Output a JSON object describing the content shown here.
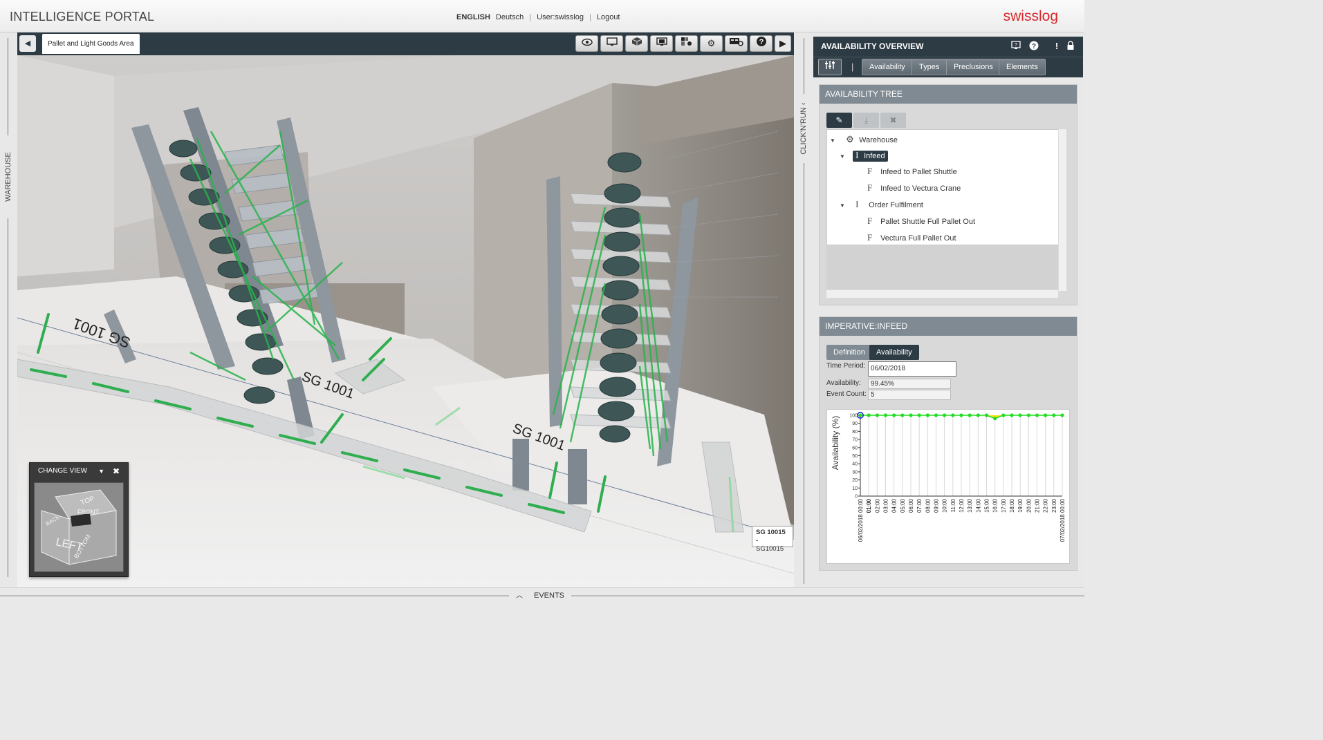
{
  "header": {
    "title": "INTELLIGENCE PORTAL",
    "lang_active": "ENGLISH",
    "lang_other": "Deutsch",
    "separator": "|",
    "user": "User:swisslog",
    "logout": "Logout",
    "logo": "swisslog"
  },
  "side_left": {
    "label": "WAREHOUSE MANAGER"
  },
  "side_mid": {
    "label": "CLICK'N'RUN"
  },
  "footer": {
    "label": "EVENTS"
  },
  "viewport": {
    "tab_label": "Pallet and Light Goods Area",
    "tools": [
      "eye-icon",
      "monitor-icon",
      "cube-icon",
      "screen-icon",
      "layout-icon",
      "gear-icon",
      "view-toggle-icon",
      "help-icon"
    ],
    "change_view": {
      "title": "CHANGE VIEW",
      "faces": [
        "TOP",
        "FRONT",
        "LEFT",
        "BOTTOM",
        "BACK"
      ]
    },
    "scene_labels": [
      "SG 1001",
      "SG 1001",
      "SG 1001"
    ],
    "tooltip": {
      "line1": "SG 10015 -",
      "line2": "SG10015"
    }
  },
  "right_panel": {
    "title": "AVAILABILITY OVERVIEW",
    "tabs": [
      "Availability",
      "Types",
      "Preclusions",
      "Elements"
    ],
    "tree_section": {
      "title": "AVAILABILITY TREE",
      "nodes": [
        {
          "icon": "gear-icon",
          "label": "Warehouse",
          "level": 0,
          "toggle": "▼"
        },
        {
          "icon": "I",
          "label": "Infeed",
          "level": 1,
          "toggle": "▼",
          "selected": true
        },
        {
          "icon": "F",
          "label": "Infeed to Pallet Shuttle",
          "level": 2
        },
        {
          "icon": "F",
          "label": "Infeed to Vectura Crane",
          "level": 2
        },
        {
          "icon": "I",
          "label": "Order Fulfilment",
          "level": 1,
          "toggle": "▼"
        },
        {
          "icon": "F",
          "label": "Pallet Shuttle Full Pallet Out",
          "level": 2
        },
        {
          "icon": "F",
          "label": "Vectura Full Pallet Out",
          "level": 2
        }
      ]
    },
    "imperative_section": {
      "title": "IMPERATIVE:INFEED",
      "tabs": [
        "Definition",
        "Availability"
      ],
      "time_period_label": "Time Period:",
      "time_period_value": "06/02/2018",
      "availability_label": "Availability:",
      "availability_value": "99.45%",
      "event_count_label": "Event Count:",
      "event_count_value": "5"
    }
  },
  "colors": {
    "dark": "#2d3b45",
    "mid": "#7f8a92",
    "brand": "#d8262c",
    "series": "#22dd22",
    "dip": "#ffdd00"
  },
  "chart_data": {
    "type": "line",
    "ylabel": "Availability (%)",
    "ylim": [
      0,
      100
    ],
    "yticks": [
      0,
      10,
      20,
      30,
      40,
      50,
      60,
      70,
      80,
      90,
      100
    ],
    "x_first_label": "06/02/2018 00:00",
    "x_last_label": "07/02/2018 00:00",
    "x_labels": [
      "01:00",
      "02:00",
      "03:00",
      "04:00",
      "05:00",
      "06:00",
      "07:00",
      "08:00",
      "09:00",
      "10:00",
      "11:00",
      "12:00",
      "13:00",
      "14:00",
      "15:00",
      "16:00",
      "17:00",
      "18:00",
      "19:00",
      "20:00",
      "21:00",
      "22:00",
      "23:00"
    ],
    "highlighted_label": "01:00",
    "values": [
      100,
      100,
      100,
      100,
      100,
      100,
      100,
      100,
      100,
      100,
      100,
      100,
      100,
      100,
      100,
      100,
      96,
      100,
      100,
      100,
      100,
      100,
      100,
      100,
      100
    ],
    "grid": true
  }
}
